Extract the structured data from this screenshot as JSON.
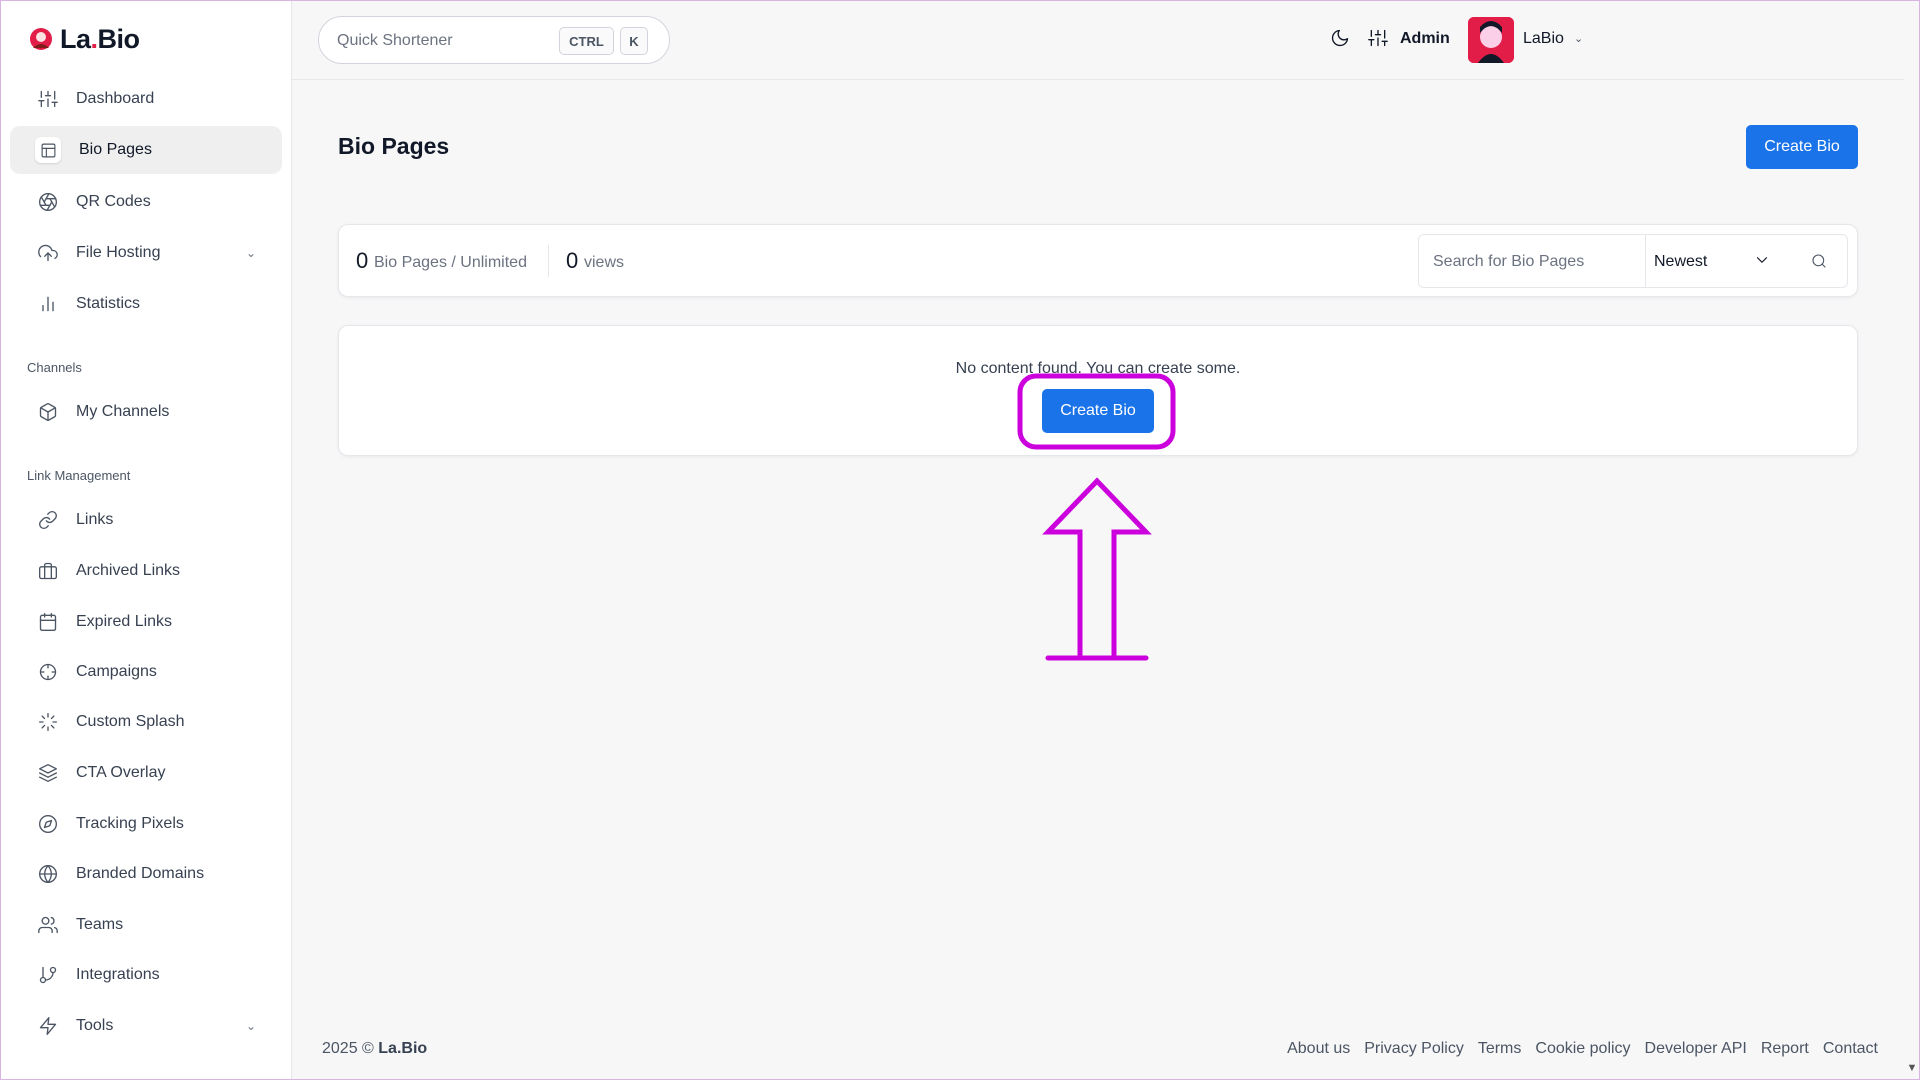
{
  "brand": {
    "name": "La.Bio",
    "name_prefix": "La",
    "name_dot": ".",
    "name_suffix": "Bio"
  },
  "sidebar": {
    "items": [
      {
        "label": "Dashboard",
        "icon": "sliders-icon"
      },
      {
        "label": "Bio Pages",
        "icon": "layout-icon",
        "active": true
      },
      {
        "label": "QR Codes",
        "icon": "aperture-icon"
      },
      {
        "label": "File Hosting",
        "icon": "upload-cloud-icon",
        "has_submenu": true
      },
      {
        "label": "Statistics",
        "icon": "bar-chart-icon"
      }
    ],
    "channels_title": "Channels",
    "channels_items": [
      {
        "label": "My Channels",
        "icon": "box-icon"
      }
    ],
    "link_management_title": "Link Management",
    "link_items": [
      {
        "label": "Links",
        "icon": "link-icon"
      },
      {
        "label": "Archived Links",
        "icon": "briefcase-icon"
      },
      {
        "label": "Expired Links",
        "icon": "calendar-icon"
      },
      {
        "label": "Campaigns",
        "icon": "crosshair-icon"
      },
      {
        "label": "Custom Splash",
        "icon": "loader-icon"
      },
      {
        "label": "CTA Overlay",
        "icon": "layers-icon"
      },
      {
        "label": "Tracking Pixels",
        "icon": "compass-icon"
      },
      {
        "label": "Branded Domains",
        "icon": "globe-icon"
      },
      {
        "label": "Teams",
        "icon": "users-icon"
      },
      {
        "label": "Integrations",
        "icon": "git-branch-icon"
      },
      {
        "label": "Tools",
        "icon": "zap-icon",
        "has_submenu": true
      }
    ]
  },
  "topbar": {
    "quick_placeholder": "Quick Shortener",
    "kbd_ctrl": "CTRL",
    "kbd_k": "K",
    "user_role": "Admin",
    "user_name": "LaBio"
  },
  "main": {
    "title": "Bio Pages",
    "create_button": "Create Bio",
    "stats": {
      "pages_count": "0",
      "pages_label": "Bio Pages / Unlimited",
      "views_count": "0",
      "views_label": "views"
    },
    "search_placeholder": "Search for Bio Pages",
    "sort_selected": "Newest",
    "empty_message": "No content found. You can create some.",
    "empty_create_button": "Create Bio"
  },
  "footer": {
    "year": "2025 ©",
    "brand": "La.Bio",
    "links": [
      "About us",
      "Privacy Policy",
      "Terms",
      "Cookie policy",
      "Developer API",
      "Report",
      "Contact"
    ]
  },
  "annotation_color": "#cc00dd",
  "accent_color": "#1a73e8"
}
